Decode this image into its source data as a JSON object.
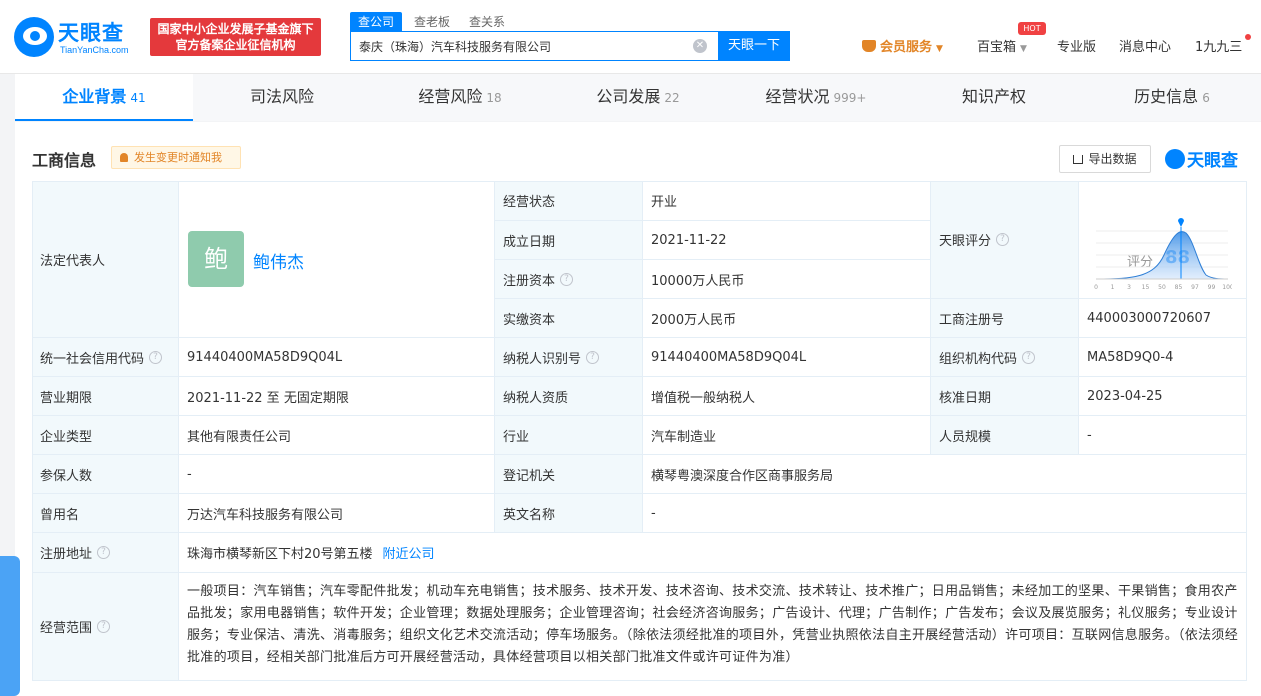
{
  "header": {
    "logo_name": "天眼查",
    "logo_domain": "TianYanCha.com",
    "badge_line1": "国家中小企业发展子基金旗下",
    "badge_line2": "官方备案企业征信机构",
    "search_tabs": [
      "查公司",
      "查老板",
      "查关系"
    ],
    "search_value": "泰庆（珠海）汽车科技服务有限公司",
    "search_button": "天眼一下",
    "nav": {
      "vip": "会员服务",
      "baibaoxiang": "百宝箱",
      "hot": "HOT",
      "pro": "专业版",
      "messages": "消息中心",
      "user": "1九九三"
    }
  },
  "tabs": [
    {
      "label": "企业背景",
      "count": "41"
    },
    {
      "label": "司法风险",
      "count": ""
    },
    {
      "label": "经营风险",
      "count": "18"
    },
    {
      "label": "公司发展",
      "count": "22"
    },
    {
      "label": "经营状况",
      "count": "999+"
    },
    {
      "label": "知识产权",
      "count": ""
    },
    {
      "label": "历史信息",
      "count": "6"
    }
  ],
  "section": {
    "title": "工商信息",
    "notify": "发生变更时通知我",
    "export": "导出数据",
    "brand": "天眼查"
  },
  "info": {
    "legal_rep_label": "法定代表人",
    "legal_rep_avatar": "鲍",
    "legal_rep_name": "鲍伟杰",
    "status_label": "经营状态",
    "status": "开业",
    "founded_label": "成立日期",
    "founded": "2021-11-22",
    "reg_capital_label": "注册资本",
    "reg_capital": "10000万人民币",
    "paid_capital_label": "实缴资本",
    "paid_capital": "2000万人民币",
    "tianyan_score_label": "天眼评分",
    "score_label": "评分",
    "score": "88",
    "score_ticks": [
      "0",
      "1",
      "3",
      "15",
      "50",
      "85",
      "97",
      "99",
      "100"
    ],
    "reg_no_label": "工商注册号",
    "reg_no": "440003000720607",
    "credit_code_label": "统一社会信用代码",
    "credit_code": "91440400MA58D9Q04L",
    "taxpayer_id_label": "纳税人识别号",
    "taxpayer_id": "91440400MA58D9Q04L",
    "org_code_label": "组织机构代码",
    "org_code": "MA58D9Q0-4",
    "term_label": "营业期限",
    "term": "2021-11-22 至 无固定期限",
    "taxpayer_qual_label": "纳税人资质",
    "taxpayer_qual": "增值税一般纳税人",
    "approve_date_label": "核准日期",
    "approve_date": "2023-04-25",
    "type_label": "企业类型",
    "type": "其他有限责任公司",
    "industry_label": "行业",
    "industry": "汽车制造业",
    "staff_label": "人员规模",
    "staff": "-",
    "insured_label": "参保人数",
    "insured": "-",
    "authority_label": "登记机关",
    "authority": "横琴粤澳深度合作区商事服务局",
    "former_name_label": "曾用名",
    "former_name": "万达汽车科技服务有限公司",
    "english_name_label": "英文名称",
    "english_name": "-",
    "address_label": "注册地址",
    "address": "珠海市横琴新区下村20号第五楼",
    "nearby": "附近公司",
    "scope_label": "经营范围",
    "scope": "一般项目：汽车销售；汽车零配件批发；机动车充电销售；技术服务、技术开发、技术咨询、技术交流、技术转让、技术推广；日用品销售；未经加工的坚果、干果销售；食用农产品批发；家用电器销售；软件开发；企业管理；数据处理服务；企业管理咨询；社会经济咨询服务；广告设计、代理；广告制作；广告发布；会议及展览服务；礼仪服务；专业设计服务；专业保洁、清洗、消毒服务；组织文化艺术交流活动；停车场服务。（除依法须经批准的项目外，凭营业执照依法自主开展经营活动）许可项目：互联网信息服务。（依法须经批准的项目，经相关部门批准后方可开展经营活动，具体经营项目以相关部门批准文件或许可证件为准）"
  },
  "colors": {
    "brand": "#0084ff",
    "label_bg": "#f2f9fc",
    "vip": "#e28527",
    "badge": "#e4393c"
  }
}
